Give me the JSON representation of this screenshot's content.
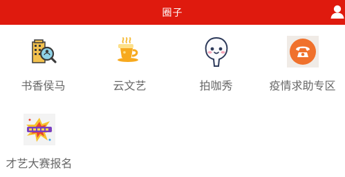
{
  "header": {
    "title": "圈子"
  },
  "theme": {
    "header_bg": "#df1a0e",
    "label_color": "#666666"
  },
  "tiles": [
    {
      "label": "书香侯马",
      "icon": "library-search-icon"
    },
    {
      "label": "云文艺",
      "icon": "coffee-cup-icon"
    },
    {
      "label": "拍咖秀",
      "icon": "smiling-face-icon"
    },
    {
      "label": "疫情求助专区",
      "icon": "telephone-icon"
    },
    {
      "label": "才艺大赛报名",
      "icon": "talent-contest-banner-icon"
    }
  ]
}
